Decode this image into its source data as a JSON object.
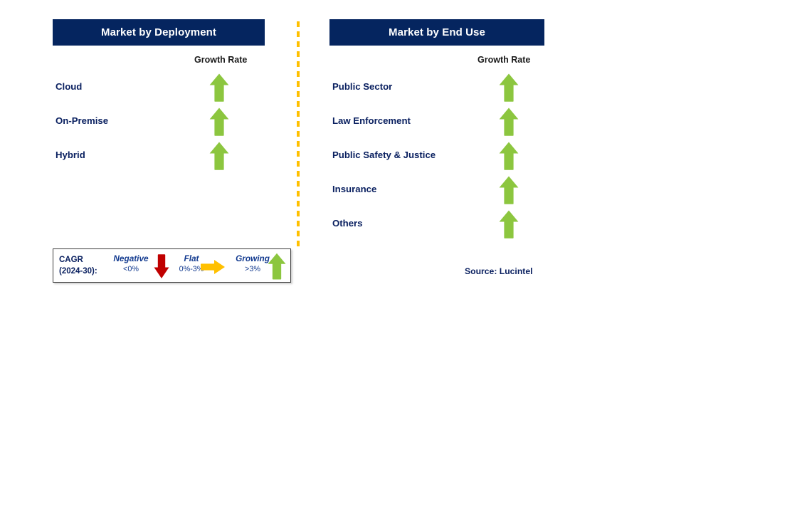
{
  "columns": [
    {
      "id": "deployment",
      "title": "Market by Deployment",
      "growth_rate_header": "Growth Rate",
      "rows": [
        {
          "label": "Cloud",
          "trend": "growing",
          "trend_icon": "arrow-up-green-icon"
        },
        {
          "label": "On-Premise",
          "trend": "growing",
          "trend_icon": "arrow-up-green-icon"
        },
        {
          "label": "Hybrid",
          "trend": "growing",
          "trend_icon": "arrow-up-green-icon"
        }
      ]
    },
    {
      "id": "end-use",
      "title": "Market by End Use",
      "growth_rate_header": "Growth Rate",
      "rows": [
        {
          "label": "Public Sector",
          "trend": "growing",
          "trend_icon": "arrow-up-green-icon"
        },
        {
          "label": "Law Enforcement",
          "trend": "growing",
          "trend_icon": "arrow-up-green-icon"
        },
        {
          "label": "Public Safety & Justice",
          "trend": "growing",
          "trend_icon": "arrow-up-green-icon"
        },
        {
          "label": "Insurance",
          "trend": "growing",
          "trend_icon": "arrow-up-green-icon"
        },
        {
          "label": "Others",
          "trend": "growing",
          "trend_icon": "arrow-up-green-icon"
        }
      ]
    }
  ],
  "legend": {
    "cagr_line1": "CAGR",
    "cagr_line2": "(2024-30):",
    "items": [
      {
        "name": "Negative",
        "range": "<0%",
        "icon": "arrow-down-red-icon",
        "color": "#C00000"
      },
      {
        "name": "Flat",
        "range": "0%-3%",
        "icon": "arrow-right-orange-icon",
        "color": "#FFC000"
      },
      {
        "name": "Growing",
        "range": ">3%",
        "icon": "arrow-up-green-icon",
        "color": "#8CC63F"
      }
    ]
  },
  "source": "Source: Lucintel",
  "colors": {
    "header_navy": "#05255F",
    "label_navy": "#0A2060",
    "growing_green": "#8CC63F",
    "negative_red": "#C00000",
    "flat_orange": "#FFC000",
    "divider_orange": "#FFC000"
  }
}
